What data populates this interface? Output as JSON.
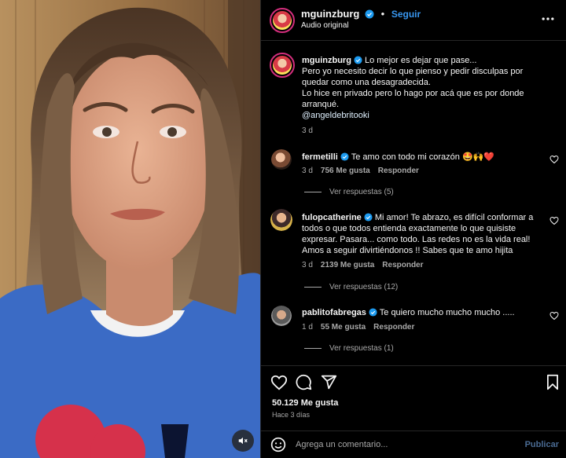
{
  "header": {
    "username": "mguinzburg",
    "separator": "•",
    "follow_label": "Seguir",
    "audio": "Audio original"
  },
  "caption": {
    "username": "mguinzburg",
    "line1": "Lo mejor es dejar que pase...",
    "line2": "Pero yo necesito decir lo que pienso y pedir disculpas por quedar como una desagradecida.",
    "line3": "Lo hice en privado pero lo hago por acá que es por donde arranqué.",
    "mention": "@angeldebritooki",
    "time": "3 d"
  },
  "comments": [
    {
      "username": "fermetilli",
      "text": "Te amo con todo mi corazón 🤩🙌❤️",
      "time": "3 d",
      "likes": "756 Me gusta",
      "reply": "Responder",
      "replies": "Ver respuestas (5)"
    },
    {
      "username": "fulopcatherine",
      "text": "Mi amor! Te abrazo, es difícil conformar a todos o que todos entienda exactamente lo que quisiste expresar. Pasara... como todo. Las redes no es la vida real! Amos a seguir divirtiéndonos !! Sabes que te amo hijita",
      "time": "3 d",
      "likes": "2139 Me gusta",
      "reply": "Responder",
      "replies": "Ver respuestas (12)"
    },
    {
      "username": "pablitofabregas",
      "text": "Te quiero mucho mucho mucho .....",
      "time": "1 d",
      "likes": "55 Me gusta",
      "reply": "Responder",
      "replies": "Ver respuestas (1)"
    }
  ],
  "post": {
    "likes": "50.129 Me gusta",
    "ago": "Hace 3 días"
  },
  "comment_box": {
    "placeholder": "Agrega un comentario...",
    "publish": "Publicar"
  },
  "colors": {
    "accent": "#3897f0",
    "verified": "#1d9bf0",
    "background": "#000000",
    "muted": "#a8a8a8"
  },
  "icons": [
    "verified-icon",
    "more-icon",
    "heart-icon",
    "comment-icon",
    "share-icon",
    "save-icon",
    "emoji-icon",
    "mute-icon"
  ]
}
